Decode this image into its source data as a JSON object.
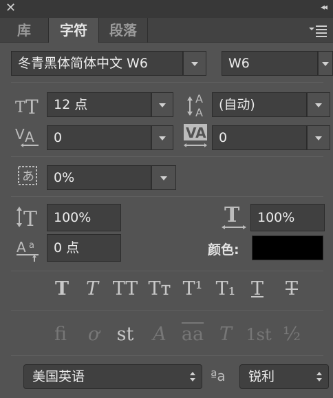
{
  "window": {
    "close_glyph": "✕",
    "collapse_glyph": "◂◂"
  },
  "tabs": [
    {
      "label": "库"
    },
    {
      "label": "字符"
    },
    {
      "label": "段落"
    }
  ],
  "font": {
    "family": "冬青黑体简体中文 W6",
    "style": "W6"
  },
  "size": {
    "font_size": "12 点",
    "leading": "(自动)"
  },
  "spacing": {
    "kerning": "0",
    "tracking": "0",
    "tsume": "0%"
  },
  "scale": {
    "vertical": "100%",
    "horizontal": "100%"
  },
  "baseline": {
    "shift": "0 点"
  },
  "color": {
    "label": "颜色:",
    "value": "#000000"
  },
  "typeface_buttons": [
    "T",
    "T",
    "TT",
    "Tт",
    "T¹",
    "T₁",
    "T",
    "T"
  ],
  "opentype_buttons": [
    "fi",
    "ơ",
    "st",
    "A",
    "aa",
    "T",
    "1st",
    "½"
  ],
  "language": {
    "value": "美国英语"
  },
  "antialias": {
    "icon_text": "ªa",
    "value": "锐利"
  }
}
